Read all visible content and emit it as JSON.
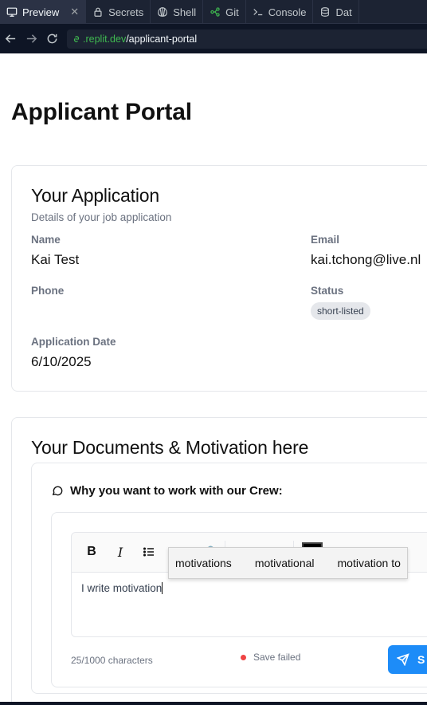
{
  "tabs": [
    {
      "label": "Preview",
      "icon": "monitor-icon"
    },
    {
      "label": "Secrets",
      "icon": "lock-icon"
    },
    {
      "label": "Shell",
      "icon": "shell-icon"
    },
    {
      "label": "Git",
      "icon": "git-icon"
    },
    {
      "label": "Console",
      "icon": "terminal-icon"
    },
    {
      "label": "Dat",
      "icon": "database-icon"
    }
  ],
  "url": {
    "domain": ".replit.dev",
    "path": "/applicant-portal"
  },
  "page": {
    "title": "Applicant Portal"
  },
  "application": {
    "title": "Your Application",
    "subtitle": "Details of your job application",
    "name_label": "Name",
    "name_value": "Kai Test",
    "email_label": "Email",
    "email_value": "kai.tchong@live.nl",
    "phone_label": "Phone",
    "status_label": "Status",
    "status_value": "short-listed",
    "date_label": "Application Date",
    "date_value": "6/10/2025"
  },
  "documents": {
    "title": "Your Documents & Motivation here",
    "question": "Why you want to work with our Crew:",
    "editor_text": "I write motivation",
    "suggestions": [
      "motivations",
      "motivational",
      "motivation to"
    ],
    "char_count": "25/1000 characters",
    "save_status": "Save failed",
    "send_label": "S"
  },
  "colors": {
    "accent": "#1d8cf8",
    "error": "#ef4444",
    "domain": "#3fb950"
  }
}
